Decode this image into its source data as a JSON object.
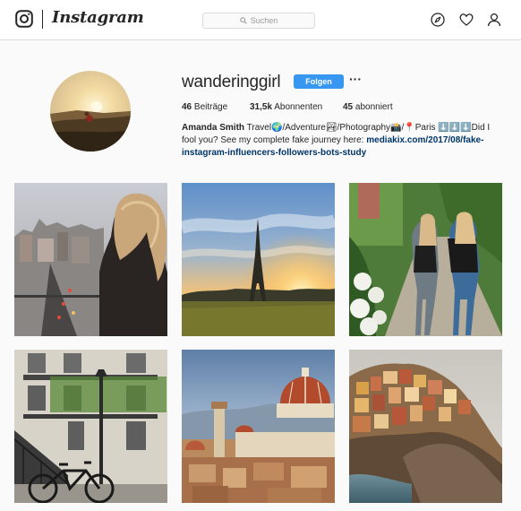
{
  "header": {
    "logo_text": "Instagram",
    "search_placeholder": "Suchen",
    "icons": [
      "instagram-icon",
      "explore-compass-icon",
      "heart-icon",
      "profile-icon"
    ]
  },
  "profile": {
    "username": "wanderinggirl",
    "follow_label": "Folgen",
    "more_label": "···",
    "stats": [
      {
        "value": "46",
        "label": "Beiträge"
      },
      {
        "value": "31,5k",
        "label": "Abonnenten"
      },
      {
        "value": "45",
        "label": "abonniert"
      }
    ],
    "bio": {
      "name": "Amanda Smith",
      "text": "Travel🌍/Adventure🏞/Photography📸/📍Paris ⬇️⬇️⬇️Did I fool you? See my complete fake journey here: ",
      "link": "mediakix.com/2017/08/fake-instagram-influencers-followers-bots-study"
    }
  },
  "grid": {
    "posts": [
      {
        "name": "post-city-overlook"
      },
      {
        "name": "post-eiffel-sunset"
      },
      {
        "name": "post-two-hikers"
      },
      {
        "name": "post-paris-bicycle"
      },
      {
        "name": "post-florence-dome"
      },
      {
        "name": "post-cinque-terre"
      }
    ]
  },
  "colors": {
    "accent": "#3897f0",
    "link": "#003569",
    "background": "#fafafa",
    "border": "#dbdbdb"
  }
}
